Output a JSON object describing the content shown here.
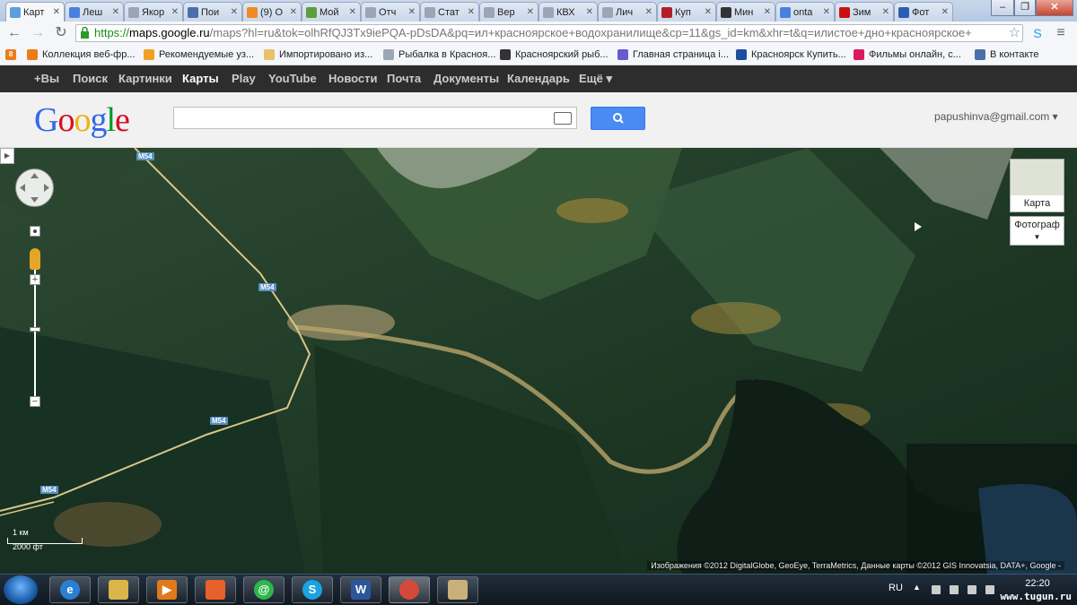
{
  "browser": {
    "tabs": [
      {
        "label": "Карт",
        "color": "#5aa0e0",
        "glyph": "",
        "active": true
      },
      {
        "label": "Леш",
        "color": "#4a7fe0",
        "glyph": "8"
      },
      {
        "label": "Якор",
        "color": "#9aa6b5",
        "glyph": ""
      },
      {
        "label": "Пои",
        "color": "#4b6fa8",
        "glyph": "В"
      },
      {
        "label": "(9) О",
        "color": "#f08a24",
        "glyph": ""
      },
      {
        "label": "Мой",
        "color": "#5b9e3c",
        "glyph": ""
      },
      {
        "label": "Отч",
        "color": "#9aa6b5",
        "glyph": ""
      },
      {
        "label": "Стат",
        "color": "#9aa6b5",
        "glyph": ""
      },
      {
        "label": "Вер",
        "color": "#9aa6b5",
        "glyph": ""
      },
      {
        "label": "КВХ",
        "color": "#9aa6b5",
        "glyph": ""
      },
      {
        "label": "Лич",
        "color": "#9aa6b5",
        "glyph": ""
      },
      {
        "label": "Куп",
        "color": "#b31d2b",
        "glyph": ""
      },
      {
        "label": "Мин",
        "color": "#333333",
        "glyph": ""
      },
      {
        "label": "onta",
        "color": "#4a7fe0",
        "glyph": "8"
      },
      {
        "label": "Зим",
        "color": "#cc1010",
        "glyph": ""
      },
      {
        "label": "Фот",
        "color": "#2a5db0",
        "glyph": ""
      }
    ],
    "url": {
      "scheme": "https://",
      "host": "maps.google.ru",
      "rest": "/maps?hl=ru&tok=olhRfQJ3Tx9iePQA-pDsDA&pq=ил+красноярское+водохранилище&cp=11&gs_id=km&xhr=t&q=илистое+дно+красноярское+"
    },
    "bookmarks": [
      {
        "label": "Коллекция веб-фр...",
        "color": "#ec7b1a"
      },
      {
        "label": "Рекомендуемые уз...",
        "color": "#f0a020"
      },
      {
        "label": "Импортировано из...",
        "color": "#e6c26a"
      },
      {
        "label": "Рыбалка в Красноя...",
        "color": "#9aa6b5"
      },
      {
        "label": "Красноярский рыб...",
        "color": "#333333"
      },
      {
        "label": "Главная страница i...",
        "color": "#6a5acd"
      },
      {
        "label": "Красноярск Купить...",
        "color": "#1d4f9e"
      },
      {
        "label": "Фильмы онлайн, с...",
        "color": "#d81b60"
      },
      {
        "label": "В контакте",
        "color": "#4b6fa8"
      }
    ]
  },
  "gbar": {
    "items": [
      "+Вы",
      "Поиск",
      "Картинки",
      "Карты",
      "Play",
      "YouTube",
      "Новости",
      "Почта",
      "Документы",
      "Календарь",
      "Ещё ▾"
    ],
    "active": "Карты"
  },
  "header": {
    "logo": "Google",
    "account": "papushinva@gmail.com"
  },
  "map": {
    "road_labels": [
      "M54",
      "M54",
      "M54",
      "M54"
    ],
    "maptype_map": "Карта",
    "maptype_photo": "Фотограф",
    "scale_km": "1 км",
    "scale_ft": "2000 фт",
    "attribution": "Изображения ©2012 DigitalGlobe, GeoEye, TerraMetrics, Данные карты ©2012 GIS Innovatsia, DATA+, Google -"
  },
  "taskbar": {
    "apps": [
      {
        "name": "ie",
        "color": "#2a7fd4",
        "glyph": "e"
      },
      {
        "name": "explorer",
        "color": "#d9b54a",
        "glyph": ""
      },
      {
        "name": "media",
        "color": "#e07a1a",
        "glyph": "▶"
      },
      {
        "name": "gallery",
        "color": "#e8602a",
        "glyph": ""
      },
      {
        "name": "mail-agent",
        "color": "#2db84a",
        "glyph": "@"
      },
      {
        "name": "skype",
        "color": "#1aa3e0",
        "glyph": "S"
      },
      {
        "name": "word",
        "color": "#2b579a",
        "glyph": "W"
      },
      {
        "name": "chrome",
        "color": "#d44a3a",
        "glyph": ""
      },
      {
        "name": "folder",
        "color": "#c9b07a",
        "glyph": ""
      }
    ],
    "lang": "RU",
    "time": "22:20",
    "watermark": "www.tugun.ru"
  }
}
